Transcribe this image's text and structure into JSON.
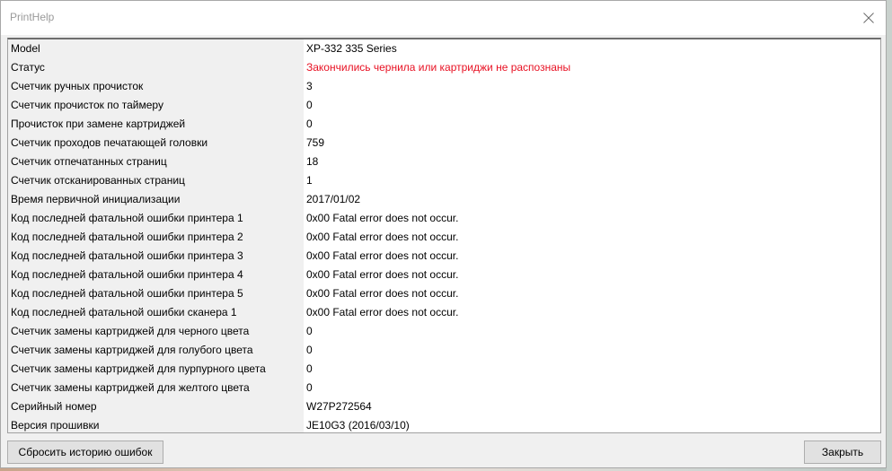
{
  "window": {
    "title": "PrintHelp"
  },
  "rows": [
    {
      "key": "Model",
      "value": "XP-332 335 Series"
    },
    {
      "key": "Статус",
      "value": "Закончились чернила или картриджи не распознаны"
    },
    {
      "key": "Счетчик ручных прочисток",
      "value": "3"
    },
    {
      "key": "Счетчик прочисток по таймеру",
      "value": "0"
    },
    {
      "key": "Прочисток при замене картриджей",
      "value": "0"
    },
    {
      "key": "Счетчик проходов печатающей головки",
      "value": "759"
    },
    {
      "key": "Счетчик отпечатанных страниц",
      "value": "18"
    },
    {
      "key": "Счетчик отсканированных страниц",
      "value": "1"
    },
    {
      "key": "Время первичной инициализации",
      "value": "2017/01/02"
    },
    {
      "key": "Код последней фатальной ошибки принтера 1",
      "value": "0x00 Fatal error does not occur."
    },
    {
      "key": "Код последней фатальной ошибки принтера 2",
      "value": "0x00 Fatal error does not occur."
    },
    {
      "key": "Код последней фатальной ошибки принтера 3",
      "value": "0x00 Fatal error does not occur."
    },
    {
      "key": "Код последней фатальной ошибки принтера 4",
      "value": "0x00 Fatal error does not occur."
    },
    {
      "key": "Код последней фатальной ошибки принтера 5",
      "value": "0x00 Fatal error does not occur."
    },
    {
      "key": "Код последней фатальной ошибки сканера 1",
      "value": "0x00 Fatal error does not occur."
    },
    {
      "key": "Счетчик замены картриджей для черного цвета",
      "value": "0"
    },
    {
      "key": "Счетчик замены картриджей для голубого цвета",
      "value": "0"
    },
    {
      "key": "Счетчик замены картриджей для пурпурного цвета",
      "value": "0"
    },
    {
      "key": "Счетчик замены картриджей для желтого цвета",
      "value": "0"
    },
    {
      "key": "Серийный номер",
      "value": "W27P272564"
    },
    {
      "key": "Версия прошивки",
      "value": "JE10G3 (2016/03/10)"
    }
  ],
  "buttons": {
    "reset_label": "Сбросить историю ошибок",
    "close_label": "Закрыть"
  },
  "colors": {
    "status_alert": "#e81123",
    "key_column_bg": "#f0f0f0"
  },
  "icons": {
    "close": "close-icon"
  }
}
